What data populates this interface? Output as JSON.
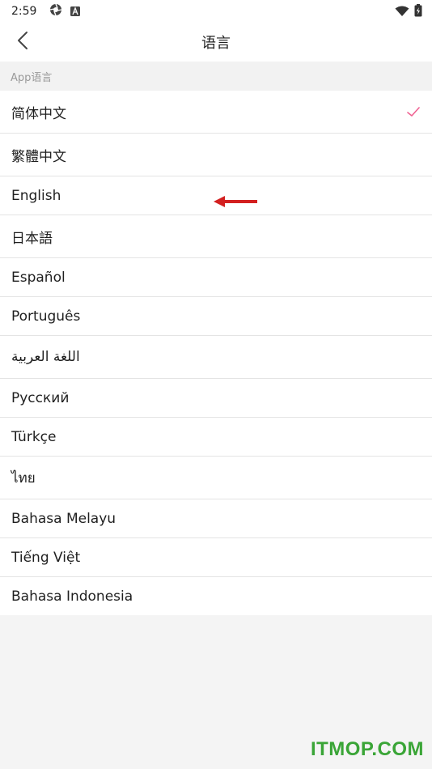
{
  "status_bar": {
    "time": "2:59"
  },
  "nav": {
    "title": "语言"
  },
  "section": {
    "header": "App语言"
  },
  "languages": [
    {
      "label": "简体中文",
      "selected": true
    },
    {
      "label": "繁體中文",
      "selected": false
    },
    {
      "label": "English",
      "selected": false
    },
    {
      "label": "日本語",
      "selected": false
    },
    {
      "label": "Español",
      "selected": false
    },
    {
      "label": "Português",
      "selected": false
    },
    {
      "label": "اللغة العربية",
      "selected": false
    },
    {
      "label": "Русский",
      "selected": false
    },
    {
      "label": "Türkçe",
      "selected": false
    },
    {
      "label": "ไทย",
      "selected": false
    },
    {
      "label": "Bahasa Melayu",
      "selected": false
    },
    {
      "label": "Tiếng Việt",
      "selected": false
    },
    {
      "label": "Bahasa Indonesia",
      "selected": false
    }
  ],
  "colors": {
    "accent": "#f06292",
    "annotation": "#d32020",
    "watermark": "#3aa537"
  },
  "watermark": {
    "text": "ITMOP.COM"
  }
}
